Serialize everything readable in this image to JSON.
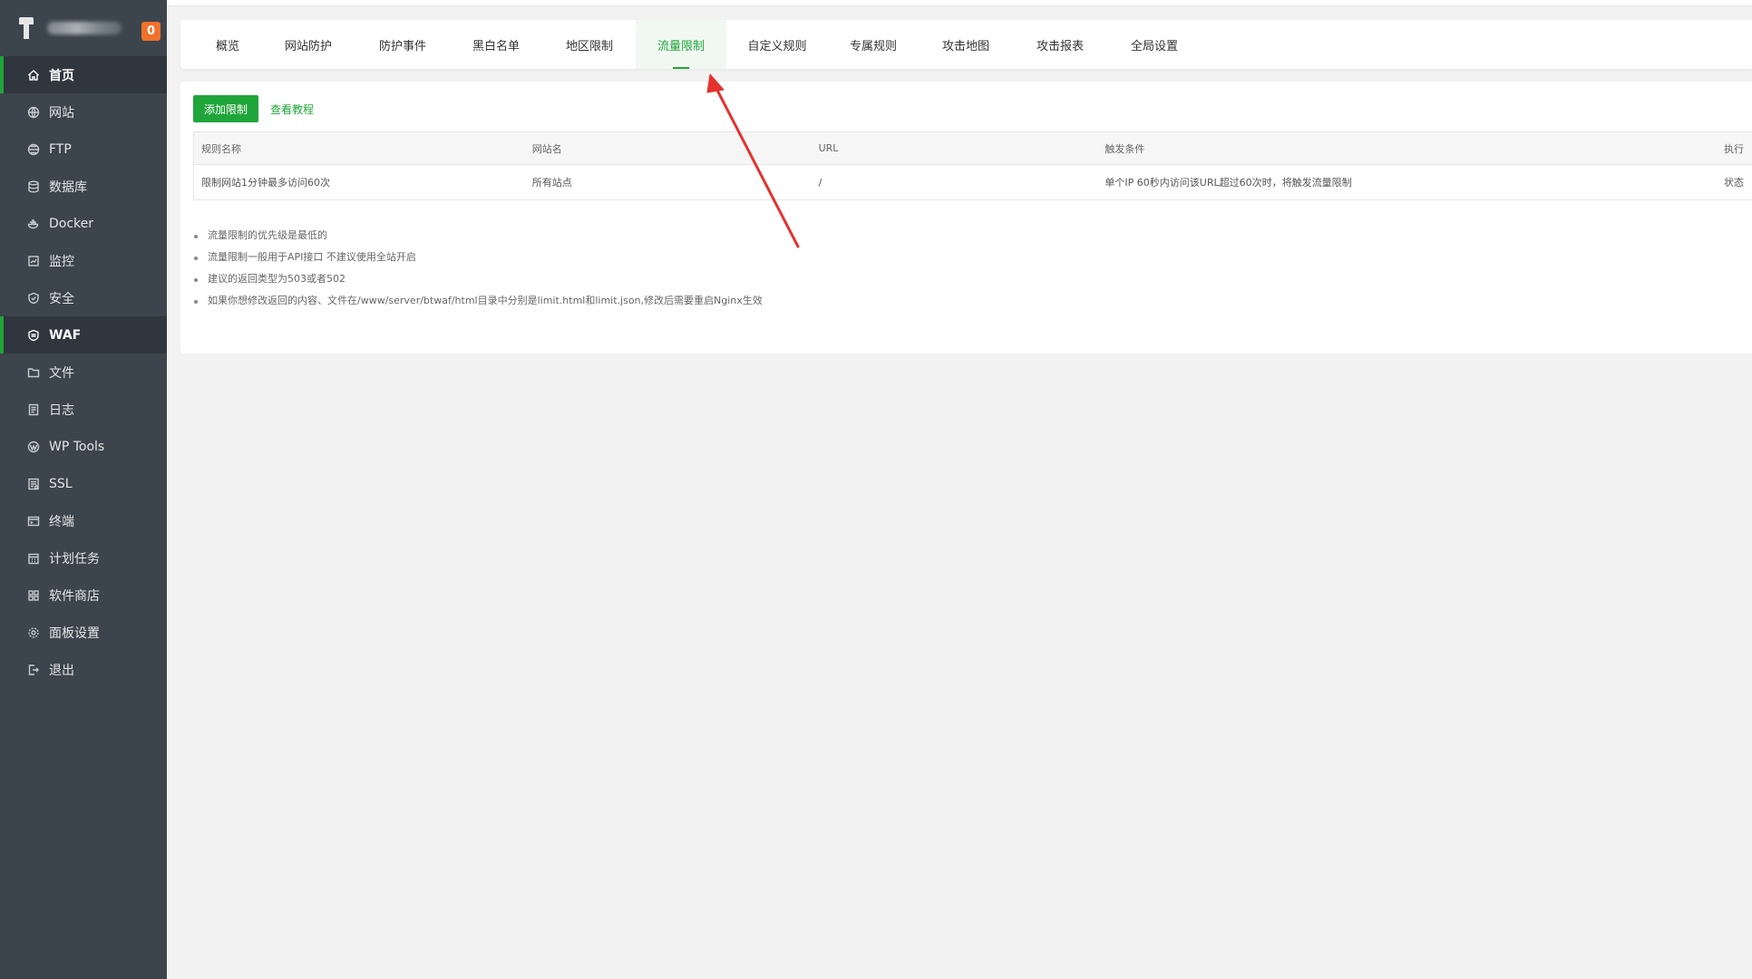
{
  "sidebar": {
    "badge": "0",
    "items": [
      {
        "label": "首页",
        "icon": "home-icon",
        "active": true
      },
      {
        "label": "网站",
        "icon": "globe-icon"
      },
      {
        "label": "FTP",
        "icon": "ftp-icon"
      },
      {
        "label": "数据库",
        "icon": "database-icon"
      },
      {
        "label": "Docker",
        "icon": "docker-icon"
      },
      {
        "label": "监控",
        "icon": "monitor-icon"
      },
      {
        "label": "安全",
        "icon": "shield-icon"
      },
      {
        "label": "WAF",
        "icon": "waf-shield-icon",
        "active": true
      },
      {
        "label": "文件",
        "icon": "folder-icon"
      },
      {
        "label": "日志",
        "icon": "log-icon"
      },
      {
        "label": "WP Tools",
        "icon": "wordpress-icon"
      },
      {
        "label": "SSL",
        "icon": "ssl-icon"
      },
      {
        "label": "终端",
        "icon": "terminal-icon"
      },
      {
        "label": "计划任务",
        "icon": "calendar-icon"
      },
      {
        "label": "软件商店",
        "icon": "grid-icon"
      },
      {
        "label": "面板设置",
        "icon": "gear-icon"
      },
      {
        "label": "退出",
        "icon": "logout-icon"
      }
    ]
  },
  "tabs": [
    {
      "label": "概览"
    },
    {
      "label": "网站防护"
    },
    {
      "label": "防护事件"
    },
    {
      "label": "黑白名单"
    },
    {
      "label": "地区限制"
    },
    {
      "label": "流量限制",
      "active": true
    },
    {
      "label": "自定义规则"
    },
    {
      "label": "专属规则"
    },
    {
      "label": "攻击地图"
    },
    {
      "label": "攻击报表"
    },
    {
      "label": "全局设置"
    }
  ],
  "toolbar": {
    "add_label": "添加限制",
    "tutorial_label": "查看教程"
  },
  "table": {
    "headers": [
      "规则名称",
      "网站名",
      "URL",
      "触发条件",
      "执行"
    ],
    "rows": [
      [
        "限制网站1分钟最多访问60次",
        "所有站点",
        "/",
        "单个IP 60秒内访问该URL超过60次时，将触发流量限制",
        "状态"
      ]
    ]
  },
  "notes": [
    "流量限制的优先级是最低的",
    "流量限制一般用于API接口 不建议使用全站开启",
    "建议的返回类型为503或者502",
    "如果你想修改返回的内容、文件在/www/server/btwaf/html目录中分别是limit.html和limit.json,修改后需要重启Nginx生效"
  ],
  "colors": {
    "accent": "#20a53a",
    "sidebar_bg": "#3c444d",
    "badge": "#f0712a",
    "arrow": "#e5322d"
  }
}
